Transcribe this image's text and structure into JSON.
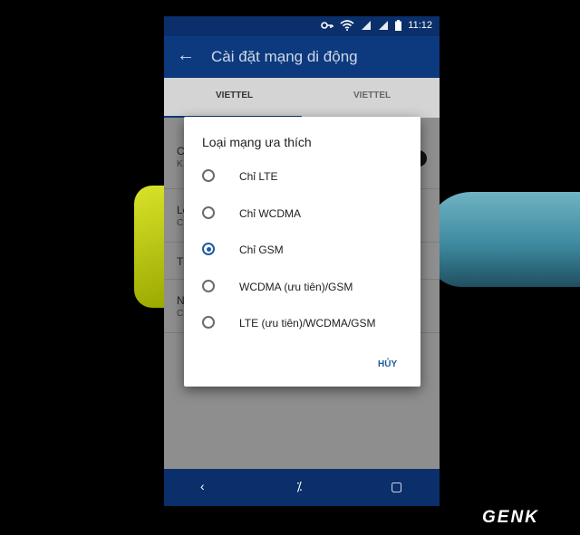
{
  "status_bar": {
    "time": "11:12",
    "icons": [
      "key-icon",
      "wifi-icon",
      "signal-icon",
      "signal-icon",
      "battery-icon"
    ]
  },
  "app_bar": {
    "title": "Cài đặt mạng di động"
  },
  "tabs": [
    {
      "label": "VIETTEL",
      "selected": true
    },
    {
      "label": "VIETTEL",
      "selected": false
    }
  ],
  "settings_partial": [
    {
      "l1": "C",
      "l2": "K"
    },
    {
      "l1": "Lo",
      "l2": "C"
    },
    {
      "l1": "Tê",
      "l2": ""
    },
    {
      "l1": "N",
      "l2": "C"
    }
  ],
  "dialog": {
    "title": "Loại mạng ưa thích",
    "options": [
      {
        "label": "Chỉ LTE",
        "selected": false
      },
      {
        "label": "Chỉ WCDMA",
        "selected": false
      },
      {
        "label": "Chỉ GSM",
        "selected": true
      },
      {
        "label": "WCDMA (ưu tiên)/GSM",
        "selected": false
      },
      {
        "label": "LTE (ưu tiên)/WCDMA/GSM",
        "selected": false
      }
    ],
    "cancel_label": "HỦY"
  },
  "nav": {
    "back": "‹",
    "home": "⁒",
    "recents": "▢"
  },
  "watermark": "GENK",
  "colors": {
    "accent": "#1e5aa0",
    "appbar": "#0d3a7e",
    "statusbar": "#0a2f6b"
  }
}
